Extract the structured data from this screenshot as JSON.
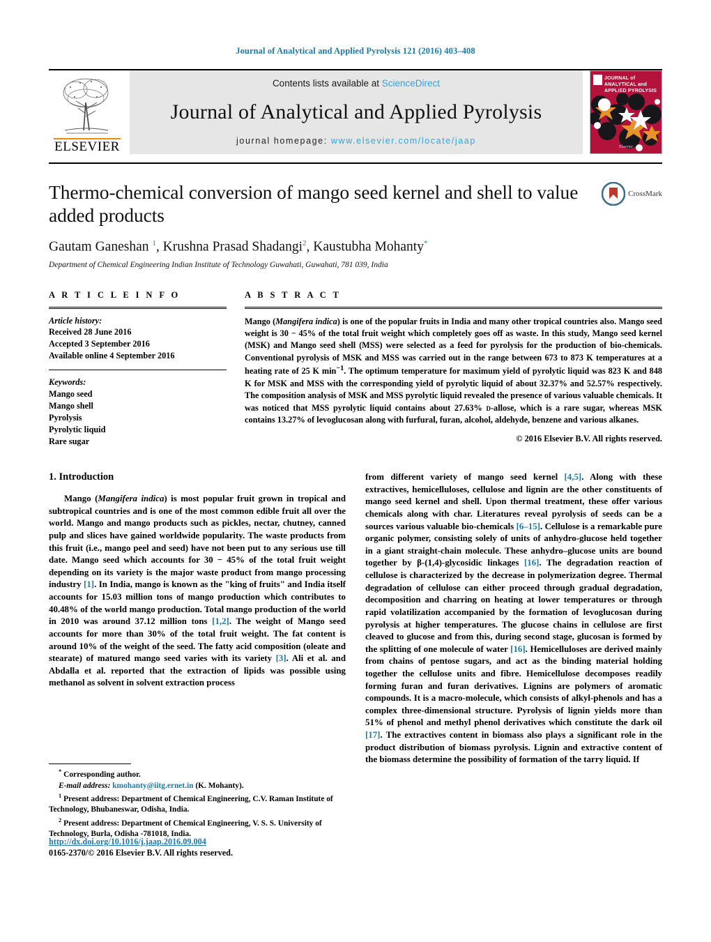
{
  "running_head": "Journal of Analytical and Applied Pyrolysis 121 (2016) 403–408",
  "masthead": {
    "contents_prefix": "Contents lists available at ",
    "sciencedirect": "ScienceDirect",
    "journal_title": "Journal of Analytical and Applied Pyrolysis",
    "homepage_prefix": "journal homepage: ",
    "homepage_url": "www.elsevier.com/locate/jaap",
    "publisher": "ELSEVIER",
    "cover_title_line1": "JOURNAL of",
    "cover_title_line2": "ANALYTICAL and",
    "cover_title_line3": "APPLIED PYROLYSIS",
    "cover_bottom": "Elsevier",
    "cover_color": "#b3123b"
  },
  "article": {
    "title": "Thermo-chemical conversion of mango seed kernel and shell to value added products",
    "crossmark_label": "CrossMark",
    "authors_html": "Gautam Ganeshan <sup>1</sup>, Krushna Prasad Shadangi<sup>2</sup>, Kaustubha Mohanty<sup class=\"plain\">*</sup>",
    "affiliation": "Department of Chemical Engineering Indian Institute of Technology Guwahati, Guwahati, 781 039, India"
  },
  "article_info": {
    "heading": "A R T I C L E    I N F O",
    "history_label": "Article history:",
    "history": [
      "Received 28 June 2016",
      "Accepted 3 September 2016",
      "Available online 4 September 2016"
    ],
    "keywords_label": "Keywords:",
    "keywords": [
      "Mango seed",
      "Mango shell",
      "Pyrolysis",
      "Pyrolytic liquid",
      "Rare sugar"
    ]
  },
  "abstract": {
    "heading": "A B S T R A C T",
    "text_html": "Mango (<em>Mangifera indica</em>) is one of the popular fruits in India and many other tropical countries also. Mango seed weight is 30 − 45% of the total fruit weight which completely goes off as waste. In this study, Mango seed kernel (MSK) and Mango seed shell (MSS) were selected as a feed for pyrolysis for the production of bio-chemicals. Conventional pyrolysis of MSK and MSS was carried out in the range between 673 to 873 K temperatures at a heating rate of 25 K min<sup>−1</sup>. The optimum temperature for maximum yield of pyrolytic liquid was 823 K and 848 K for MSK and MSS with the corresponding yield of pyrolytic liquid of about 32.37% and 52.57% respectively. The composition analysis of MSK and MSS pyrolytic liquid revealed the presence of various valuable chemicals. It was noticed that MSS pyrolytic liquid contains about 27.63% <span style=\"font-variant:small-caps\">d</span>-allose, which is a rare sugar, whereas MSK contains 13.27% of levoglucosan along with furfural, furan, alcohol, aldehyde, benzene and various alkanes.",
    "copyright": "© 2016 Elsevier B.V. All rights reserved."
  },
  "body": {
    "section_number_title": "1.  Introduction",
    "left_paragraph_html": "Mango (<em>Mangifera indica</em>) is most popular fruit grown in tropical and subtropical countries and is one of the most common edible fruit all over the world. Mango and mango products such as pickles, nectar, chutney, canned pulp and slices have gained worldwide popularity. The waste products from this fruit (i.e., mango peel and seed) have not been put to any serious use till date. Mango seed which accounts for 30 − 45% of the total fruit weight depending on its variety is the major waste product from mango processing industry <span class=\"ref\">[1]</span>. In India, mango is known as the \"king of fruits\" and India itself accounts for 15.03 million tons of mango production which contributes to 40.48% of the world mango production. Total mango production of the world in 2010 was around 37.12 million tons <span class=\"ref\">[1,2]</span>. The weight of Mango seed accounts for more than 30% of the total fruit weight. The fat content is around 10% of the weight of the seed. The fatty acid composition (oleate and stearate) of matured mango seed varies with its variety <span class=\"ref\">[3]</span>. Ali et al. and Abdalla et al. reported that the extraction of lipids was possible using methanol as solvent in solvent extraction process",
    "right_paragraph_html": "from different variety of mango seed kernel <span class=\"ref\">[4,5]</span>. Along with these extractives, hemicelluloses, cellulose and lignin are the other constituents of mango seed kernel and shell. Upon thermal treatment, these offer various chemicals along with char. Literatures reveal pyrolysis of seeds can be a sources various valuable bio-chemicals <span class=\"ref\">[6–15]</span>. Cellulose is a remarkable pure organic polymer, consisting solely of units of anhydro-glucose held together in a giant straight-chain molecule. These anhydro–glucose units are bound together by β-(1,4)-glycosidic linkages <span class=\"ref\">[16]</span>. The degradation reaction of cellulose is characterized by the decrease in polymerization degree. Thermal degradation of cellulose can either proceed through gradual degradation, decomposition and charring on heating at lower temperatures or through rapid volatilization accompanied by the formation of levoglucosan during pyrolysis at higher temperatures. The glucose chains in cellulose are first cleaved to glucose and from this, during second stage, glucosan is formed by the splitting of one molecule of water <span class=\"ref\">[16]</span>. Hemicelluloses are derived mainly from chains of pentose sugars, and act as the binding material holding together the cellulose units and fibre. Hemicellulose decomposes readily forming furan and furan derivatives. Lignins are polymers of aromatic compounds. It is a macro-molecule, which consists of alkyl-phenols and has a complex three-dimensional structure. Pyrolysis of lignin yields more than 51% of phenol and methyl phenol derivatives which constitute the dark oil <span class=\"ref\">[17]</span>. The extractives content in biomass also plays a significant role in the product distribution of biomass pyrolysis. Lignin and extractive content of the biomass determine the possibility of formation of the tarry liquid. If"
  },
  "footnotes": {
    "corresponding_html": "<sup>*</sup> Corresponding author.",
    "email_html": "<em>E-mail address:</em> <span class=\"mail\">kmohanty@iitg.ernet.in</span> (K. Mohanty).",
    "note1_html": "<sup>1</sup> Present address: Department of Chemical Engineering, C.V. Raman Institute of Technology, Bhubaneswar, Odisha, India.",
    "note2_html": "<sup>2</sup> Present address: Department of Chemical Engineering, V. S. S. University of Technology, Burla, Odisha -781018, India."
  },
  "footer": {
    "doi": "http://dx.doi.org/10.1016/j.jaap.2016.09.004",
    "issn_line": "0165-2370/© 2016 Elsevier B.V. All rights reserved."
  },
  "colors": {
    "link": "#1a7aa8",
    "sciencedirect": "#2ba6dd",
    "elsevier_orange": "#ED8B00",
    "cover_red": "#b3123b"
  }
}
